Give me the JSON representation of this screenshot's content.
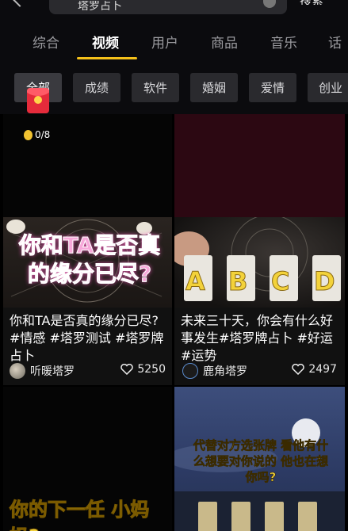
{
  "search": {
    "query": "塔罗占卜",
    "button": "搜索"
  },
  "tabs": [
    {
      "label": "综合"
    },
    {
      "label": "视频"
    },
    {
      "label": "用户"
    },
    {
      "label": "商品"
    },
    {
      "label": "音乐"
    },
    {
      "label": "话"
    }
  ],
  "active_tab": "视频",
  "chips": [
    {
      "label": "全部"
    },
    {
      "label": "成绩"
    },
    {
      "label": "软件"
    },
    {
      "label": "婚姻"
    },
    {
      "label": "爱情"
    },
    {
      "label": "创业"
    }
  ],
  "reward": {
    "progress": "0/8"
  },
  "cards": [
    {
      "overlay": "你和TA是否真的缘分已尽?",
      "title": "你和TA是否真的缘分已尽?#情感 #塔罗测试 #塔罗牌占卜",
      "author": "听暖塔罗",
      "likes": "5250"
    },
    {
      "overlay_letters": [
        "A",
        "B",
        "C",
        "D"
      ],
      "title": "未来三十天，你会有什么好事发生#塔罗牌占卜 #好运 #运势",
      "author": "鹿角塔罗",
      "likes": "2497"
    },
    {
      "overlay": "你的下一任 小妈妈?"
    },
    {
      "overlay": "代替对方选张牌 看他有什么想要对你说的 他也在想你吗?"
    }
  ],
  "colors": {
    "accent": "#f5c11a",
    "overlay_pink": "#f6a6d8",
    "overlay_yellow": "#f3d23a"
  }
}
